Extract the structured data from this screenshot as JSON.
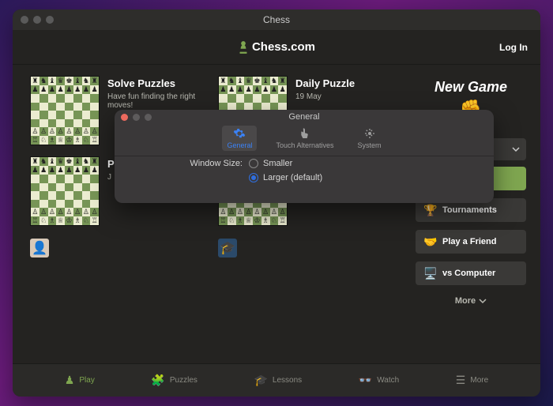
{
  "window": {
    "title": "Chess"
  },
  "brand": {
    "text": "Chess.com"
  },
  "login": "Log In",
  "cards": {
    "solve": {
      "title": "Solve Puzzles",
      "sub": "Have fun finding the right moves!"
    },
    "daily": {
      "title": "Daily Puzzle",
      "sub": "19 May"
    },
    "p3": {
      "title": "P",
      "sub": "J"
    }
  },
  "sidebar": {
    "new_game": "New Game",
    "buttons": {
      "tournaments": "Tournaments",
      "friend": "Play a Friend",
      "computer": "vs Computer"
    },
    "more": "More"
  },
  "bottomnav": {
    "play": "Play",
    "puzzles": "Puzzles",
    "lessons": "Lessons",
    "watch": "Watch",
    "more": "More"
  },
  "prefs": {
    "title": "General",
    "tabs": {
      "general": "General",
      "touch": "Touch Alternatives",
      "system": "System"
    },
    "window_size_label": "Window Size:",
    "opt_smaller": "Smaller",
    "opt_larger": "Larger (default)"
  }
}
